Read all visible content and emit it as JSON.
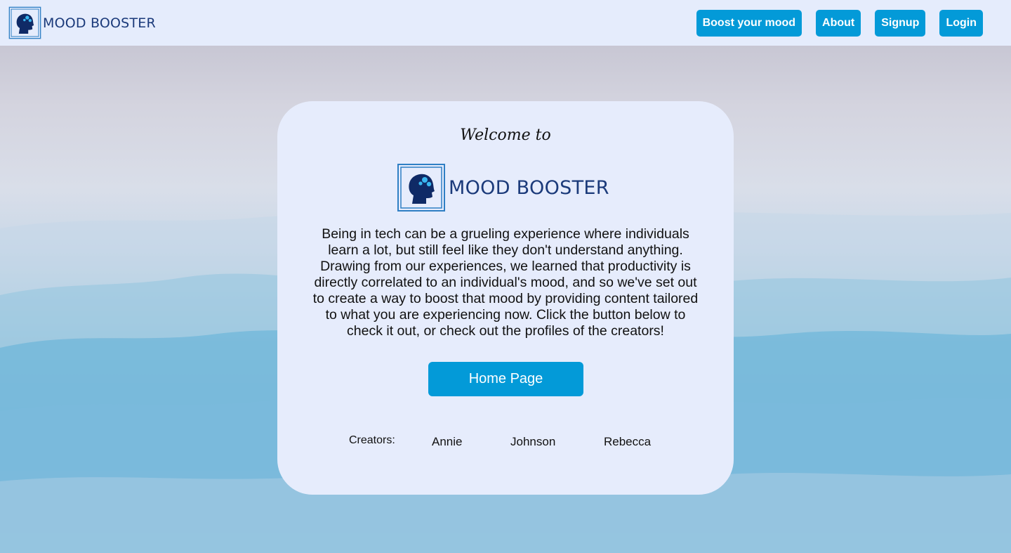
{
  "navbar": {
    "brand_text": "MOOD BOOSTER",
    "buttons": [
      "Boost your mood",
      "About",
      "Signup",
      "Login"
    ]
  },
  "card": {
    "welcome": "Welcome to",
    "brand_text": "MOOD BOOSTER",
    "description": "Being in tech can be a grueling experience where individuals learn a lot, but still feel like they don't understand anything. Drawing from our experiences, we learned that productivity is directly correlated to an individual's mood, and so we've set out to create a way to boost that mood by providing content tailored to what you are experiencing now. Click the button below to check it out, or check out the profiles of the creators!",
    "home_button": "Home Page",
    "creators_label": "Creators:",
    "creators": [
      "Annie",
      "Johnson",
      "Rebecca"
    ]
  },
  "colors": {
    "navbar_bg": "#e5ecfc",
    "button_blue": "#039ad8",
    "brand_navy": "#1b3a7a",
    "card_bg": "#e6ecfc"
  },
  "icons": {
    "logo": "head-with-gears-icon"
  }
}
